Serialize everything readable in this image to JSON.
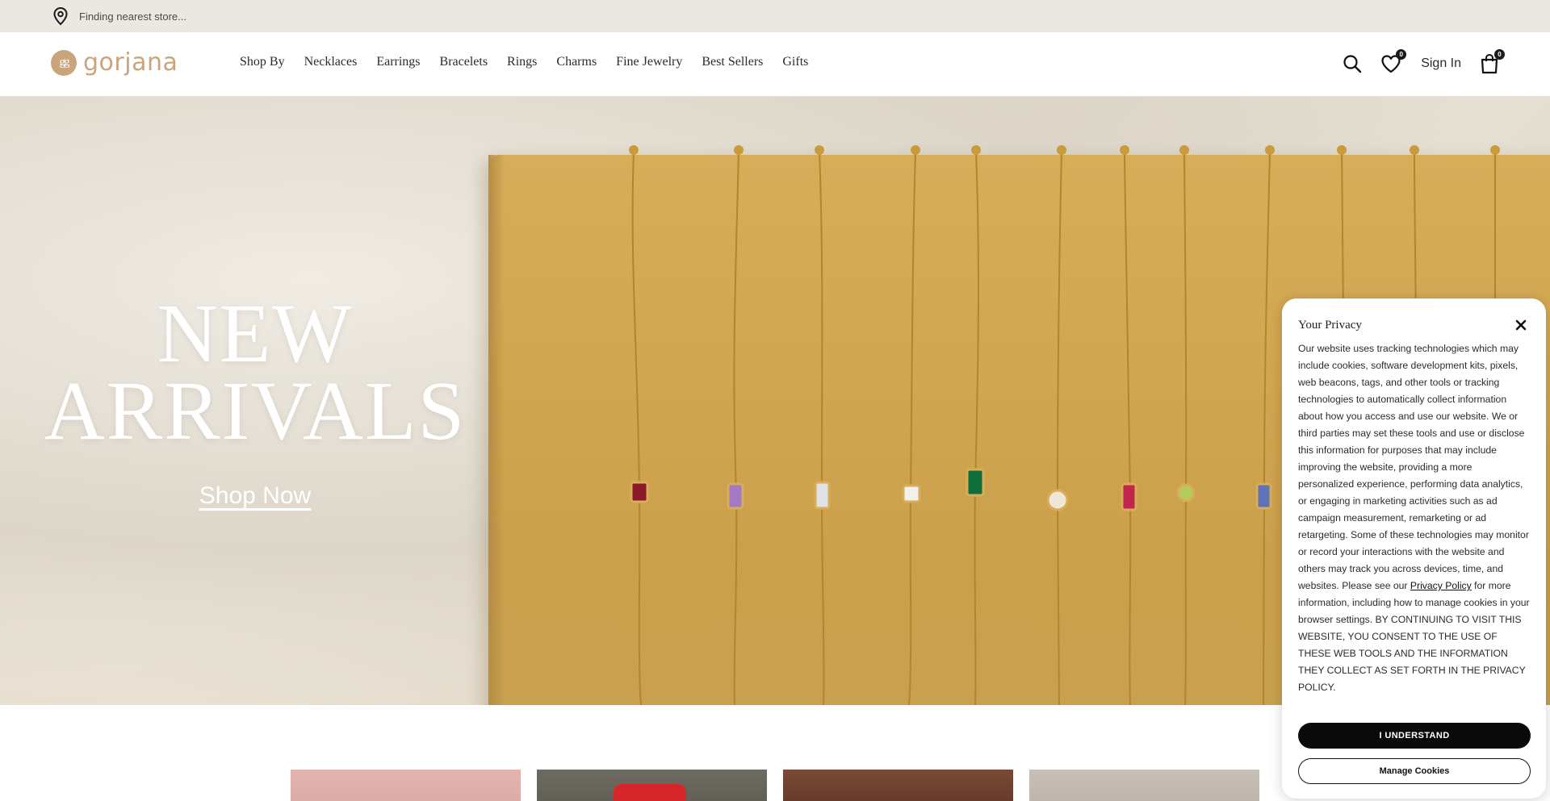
{
  "store_bar": {
    "icon": "location-pin-icon",
    "text": "Finding nearest store..."
  },
  "brand": {
    "mark": "gg",
    "name": "gorjana",
    "color": "#c9a47c"
  },
  "nav": {
    "items": [
      {
        "label": "Shop By"
      },
      {
        "label": "Necklaces"
      },
      {
        "label": "Earrings"
      },
      {
        "label": "Bracelets"
      },
      {
        "label": "Rings"
      },
      {
        "label": "Charms"
      },
      {
        "label": "Fine Jewelry"
      },
      {
        "label": "Best Sellers"
      },
      {
        "label": "Gifts"
      }
    ]
  },
  "header_actions": {
    "search_icon": "search-icon",
    "wishlist_icon": "heart-icon",
    "wishlist_count": "0",
    "signin_label": "Sign In",
    "cart_icon": "shopping-bag-icon",
    "cart_count": "0"
  },
  "hero": {
    "title_line1": "NEW",
    "title_line2": "ARRIVALS",
    "cta_label": "Shop Now"
  },
  "privacy": {
    "title": "Your Privacy",
    "close_icon": "close-icon",
    "body_part1": "Our website uses tracking technologies which may include cookies, software development kits, pixels, web beacons, tags, and other tools or tracking technologies to automatically collect information about how you access and use our website. We or third parties may set these tools and use or disclose this information for purposes that may include improving the website, providing a more personalized experience, performing data analytics, or engaging in marketing activities such as ad campaign measurement, remarketing or ad retargeting. Some of these technologies may monitor or record your interactions with the website and others may track you across devices, time, and websites. Please see our ",
    "policy_link": "Privacy Policy",
    "body_part2": " for more information, including how to manage cookies in your browser settings. BY CONTINUING TO VISIT THIS WEBSITE, YOU CONSENT TO THE USE OF THESE WEB TOOLS AND THE INFORMATION THEY COLLECT AS SET FORTH IN THE PRIVACY POLICY.",
    "accept_label": "I UNDERSTAND",
    "manage_label": "Manage Cookies"
  }
}
